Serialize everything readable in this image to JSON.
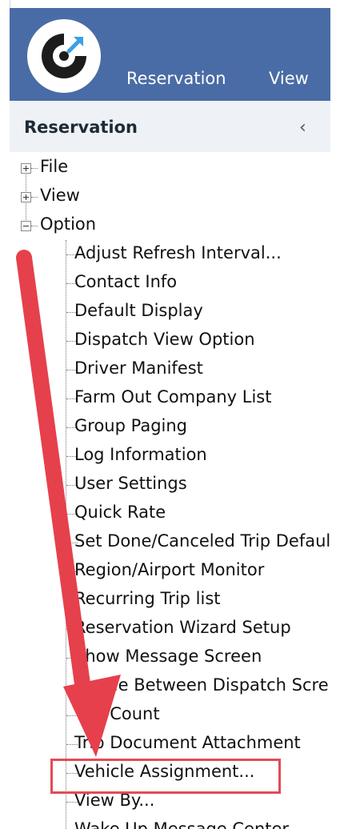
{
  "header": {
    "tabs": [
      "Reservation",
      "View"
    ]
  },
  "panel": {
    "title": "Reservation",
    "collapse_glyph": "‹"
  },
  "tree": {
    "roots": [
      {
        "label": "File",
        "state": "collapsed"
      },
      {
        "label": "View",
        "state": "collapsed"
      },
      {
        "label": "Option",
        "state": "expanded"
      }
    ],
    "option_children": [
      "Adjust Refresh Interval...",
      "Contact Info",
      "Default Display",
      "Dispatch View Option",
      "Driver Manifest",
      "Farm Out Company List",
      "Group Paging",
      "Log Information",
      "User Settings",
      "Quick Rate",
      "Set Done/Canceled Trip Defaul",
      "Region/Airport Monitor",
      "Recurring Trip list",
      "Reservation Wizard Setup",
      "Show Message Screen",
      "Toggle Between Dispatch Scre",
      "Trip Count",
      "Trip Document Attachment",
      "Vehicle Assignment...",
      "View By...",
      "Wake Up Message Center"
    ]
  },
  "colors": {
    "header": "#4a6ca6",
    "highlight": "#e34b55",
    "arrow": "#e6404c"
  },
  "icons": [
    "app-logo-icon",
    "chevron-left-icon",
    "expand-plus-icon",
    "collapse-minus-icon"
  ]
}
